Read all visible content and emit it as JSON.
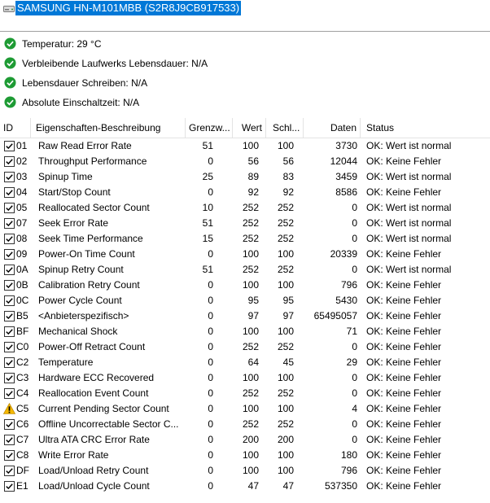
{
  "drive": {
    "name": "SAMSUNG HN-M101MBB (S2R8J9CB917533)"
  },
  "summary": [
    {
      "label": "Temperatur: 29 °C",
      "status": "ok"
    },
    {
      "label": "Verbleibende Laufwerks Lebensdauer: N/A",
      "status": "ok"
    },
    {
      "label": "Lebensdauer Schreiben: N/A",
      "status": "ok"
    },
    {
      "label": "Absolute Einschaltzeit: N/A",
      "status": "ok"
    }
  ],
  "columns": {
    "id": "ID",
    "name": "Eigenschaften-Beschreibung",
    "threshold": "Grenzw...",
    "value": "Wert",
    "worst": "Schl...",
    "data": "Daten",
    "status": "Status"
  },
  "colors": {
    "ok": "#1e9b34",
    "warning": "#f5b800",
    "selection": "#0078d7"
  },
  "rows": [
    {
      "id": "01",
      "name": "Raw Read Error Rate",
      "threshold": "51",
      "value": "100",
      "worst": "100",
      "data": "3730",
      "status": "OK: Wert ist normal",
      "icon": "check"
    },
    {
      "id": "02",
      "name": "Throughput Performance",
      "threshold": "0",
      "value": "56",
      "worst": "56",
      "data": "12044",
      "status": "OK: Keine Fehler",
      "icon": "check"
    },
    {
      "id": "03",
      "name": "Spinup Time",
      "threshold": "25",
      "value": "89",
      "worst": "83",
      "data": "3459",
      "status": "OK: Wert ist normal",
      "icon": "check"
    },
    {
      "id": "04",
      "name": "Start/Stop Count",
      "threshold": "0",
      "value": "92",
      "worst": "92",
      "data": "8586",
      "status": "OK: Keine Fehler",
      "icon": "check"
    },
    {
      "id": "05",
      "name": "Reallocated Sector Count",
      "threshold": "10",
      "value": "252",
      "worst": "252",
      "data": "0",
      "status": "OK: Wert ist normal",
      "icon": "check"
    },
    {
      "id": "07",
      "name": "Seek Error Rate",
      "threshold": "51",
      "value": "252",
      "worst": "252",
      "data": "0",
      "status": "OK: Wert ist normal",
      "icon": "check"
    },
    {
      "id": "08",
      "name": "Seek Time Performance",
      "threshold": "15",
      "value": "252",
      "worst": "252",
      "data": "0",
      "status": "OK: Wert ist normal",
      "icon": "check"
    },
    {
      "id": "09",
      "name": "Power-On Time Count",
      "threshold": "0",
      "value": "100",
      "worst": "100",
      "data": "20339",
      "status": "OK: Keine Fehler",
      "icon": "check"
    },
    {
      "id": "0A",
      "name": "Spinup Retry Count",
      "threshold": "51",
      "value": "252",
      "worst": "252",
      "data": "0",
      "status": "OK: Wert ist normal",
      "icon": "check"
    },
    {
      "id": "0B",
      "name": "Calibration Retry Count",
      "threshold": "0",
      "value": "100",
      "worst": "100",
      "data": "796",
      "status": "OK: Keine Fehler",
      "icon": "check"
    },
    {
      "id": "0C",
      "name": "Power Cycle Count",
      "threshold": "0",
      "value": "95",
      "worst": "95",
      "data": "5430",
      "status": "OK: Keine Fehler",
      "icon": "check"
    },
    {
      "id": "B5",
      "name": "<Anbieterspezifisch>",
      "threshold": "0",
      "value": "97",
      "worst": "97",
      "data": "65495057",
      "status": "OK: Keine Fehler",
      "icon": "check"
    },
    {
      "id": "BF",
      "name": "Mechanical Shock",
      "threshold": "0",
      "value": "100",
      "worst": "100",
      "data": "71",
      "status": "OK: Keine Fehler",
      "icon": "check"
    },
    {
      "id": "C0",
      "name": "Power-Off Retract Count",
      "threshold": "0",
      "value": "252",
      "worst": "252",
      "data": "0",
      "status": "OK: Keine Fehler",
      "icon": "check"
    },
    {
      "id": "C2",
      "name": "Temperature",
      "threshold": "0",
      "value": "64",
      "worst": "45",
      "data": "29",
      "status": "OK: Keine Fehler",
      "icon": "check"
    },
    {
      "id": "C3",
      "name": "Hardware ECC Recovered",
      "threshold": "0",
      "value": "100",
      "worst": "100",
      "data": "0",
      "status": "OK: Keine Fehler",
      "icon": "check"
    },
    {
      "id": "C4",
      "name": "Reallocation Event Count",
      "threshold": "0",
      "value": "252",
      "worst": "252",
      "data": "0",
      "status": "OK: Keine Fehler",
      "icon": "check"
    },
    {
      "id": "C5",
      "name": "Current Pending Sector Count",
      "threshold": "0",
      "value": "100",
      "worst": "100",
      "data": "4",
      "status": "OK: Keine Fehler",
      "icon": "warning"
    },
    {
      "id": "C6",
      "name": "Offline Uncorrectable Sector C...",
      "threshold": "0",
      "value": "252",
      "worst": "252",
      "data": "0",
      "status": "OK: Keine Fehler",
      "icon": "check"
    },
    {
      "id": "C7",
      "name": "Ultra ATA CRC Error Rate",
      "threshold": "0",
      "value": "200",
      "worst": "200",
      "data": "0",
      "status": "OK: Keine Fehler",
      "icon": "check"
    },
    {
      "id": "C8",
      "name": "Write Error Rate",
      "threshold": "0",
      "value": "100",
      "worst": "100",
      "data": "180",
      "status": "OK: Keine Fehler",
      "icon": "check"
    },
    {
      "id": "DF",
      "name": "Load/Unload Retry Count",
      "threshold": "0",
      "value": "100",
      "worst": "100",
      "data": "796",
      "status": "OK: Keine Fehler",
      "icon": "check"
    },
    {
      "id": "E1",
      "name": "Load/Unload Cycle Count",
      "threshold": "0",
      "value": "47",
      "worst": "47",
      "data": "537350",
      "status": "OK: Keine Fehler",
      "icon": "check"
    }
  ]
}
